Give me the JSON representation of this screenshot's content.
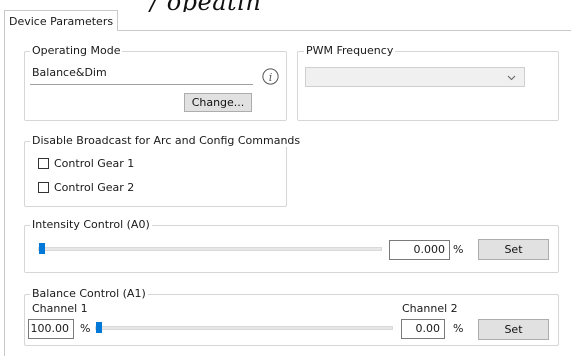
{
  "header_fragment": "/ opeatin",
  "tab": {
    "label": "Device Parameters"
  },
  "operating_mode": {
    "legend": "Operating Mode",
    "value": "Balance&Dim",
    "change_label": "Change..."
  },
  "pwm": {
    "legend": "PWM Frequency",
    "selected": ""
  },
  "broadcast": {
    "legend": "Disable Broadcast for Arc and Config Commands",
    "items": [
      {
        "label": "Control Gear 1",
        "checked": false
      },
      {
        "label": "Control Gear 2",
        "checked": false
      }
    ]
  },
  "intensity": {
    "legend": "Intensity Control (A0)",
    "value": "0.000",
    "unit": "%",
    "set_label": "Set",
    "level_fraction": 0
  },
  "balance": {
    "legend": "Balance Control (A1)",
    "channel1_label": "Channel 1",
    "channel2_label": "Channel 2",
    "channel1_value": "100.00",
    "channel2_value": "0.00",
    "unit": "%",
    "set_label": "Set",
    "level_fraction": 0
  },
  "colors": {
    "accent": "#0078d7",
    "button_bg": "#e1e1e1",
    "border": "#d6d6d6"
  }
}
